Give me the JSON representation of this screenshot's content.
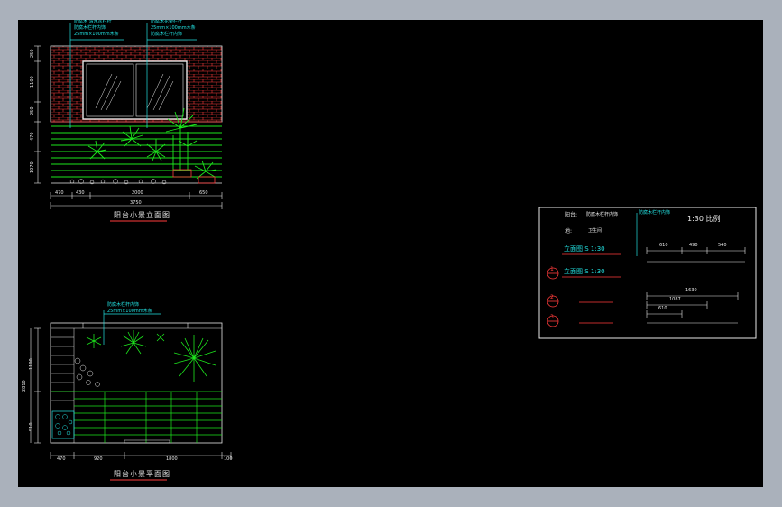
{
  "drawing": {
    "elevation_title": "阳台小景立面图",
    "plan_title": "阳台小景平面图",
    "elevation_notes": [
      "防腐木 清水灰栏杆",
      "防腐木栏杆内饰",
      "25mm×100mm木条"
    ],
    "elevation_notes_right": [
      "防腐木花架栏杆",
      "25mm×100mm木条",
      "防腐木栏杆内饰"
    ],
    "plan_notes": [
      "防腐木栏杆内饰",
      "25mm×100mm木条"
    ],
    "elevation_dims_bottom": [
      "470",
      "430",
      "2000",
      "650"
    ],
    "elevation_dims_total": "3750",
    "elevation_dims_left": [
      "250",
      "1100",
      "250",
      "470",
      "1070"
    ],
    "plan_dims_bottom": [
      "470",
      "920",
      "1800",
      "100"
    ],
    "plan_dims_left": [
      "1100",
      "2810",
      "510"
    ]
  },
  "legend": {
    "note_top_left_label": "阳台:",
    "note_top_left_value": "防腐木栏杆内饰",
    "note_top_right": "防腐木栏杆内饰",
    "floor_label": "地:",
    "floor_value": "卫生间",
    "scale_label": "1:30 比例",
    "elevation_row1": "立面图  S 1:30",
    "elevation_row2": "立面图  S 1:30",
    "marker1": "1",
    "marker2": "2",
    "marker3": "3",
    "dims_top": [
      "610",
      "490",
      "540"
    ],
    "dims_bottom_total": "1630",
    "dims_bottom_mid": "1087",
    "dims_bottom_small": "610"
  }
}
